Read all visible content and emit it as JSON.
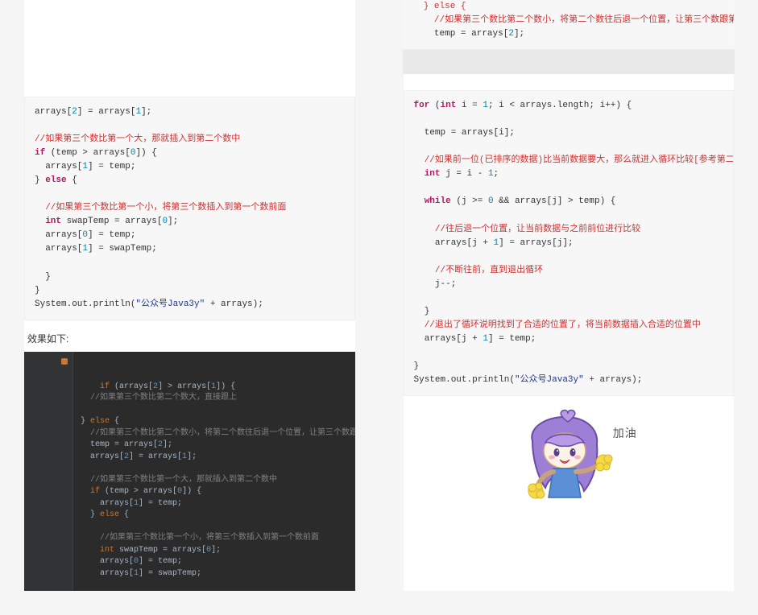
{
  "left": {
    "code_top": [
      {
        "cls": "cm-r",
        "t": "  } else {"
      },
      {
        "cls": "cm-r",
        "t": "    //如果第三个数比第二个数小，将第二个数往后退一个位置，让第三个数跟第一个数比"
      },
      {
        "cls": "",
        "t": "    temp = arrays[<span class='num'>2</span>];"
      }
    ],
    "code_main": [
      {
        "cls": "",
        "t": "arrays[<span class='num'>2</span>] = arrays[<span class='num'>1</span>];"
      },
      {
        "cls": "",
        "t": ""
      },
      {
        "cls": "cm-r",
        "t": "//如果第三个数比第一个大，那就插入到第二个数中"
      },
      {
        "cls": "",
        "t": "<span class='kw'>if</span> (temp &gt; arrays[<span class='num'>0</span>]) {"
      },
      {
        "cls": "",
        "t": "  arrays[<span class='num'>1</span>] = temp;"
      },
      {
        "cls": "",
        "t": "} <span class='kw'>else</span> {"
      },
      {
        "cls": "",
        "t": ""
      },
      {
        "cls": "cm-r",
        "t": "  //如果第三个数比第一个小，将第三个数插入到第一个数前面"
      },
      {
        "cls": "",
        "t": "  <span class='kw'>int</span> swapTemp = arrays[<span class='num'>0</span>];"
      },
      {
        "cls": "",
        "t": "  arrays[<span class='num'>0</span>] = temp;"
      },
      {
        "cls": "",
        "t": "  arrays[<span class='num'>1</span>] = swapTemp;"
      },
      {
        "cls": "",
        "t": ""
      },
      {
        "cls": "",
        "t": "  }"
      },
      {
        "cls": "",
        "t": "}"
      },
      {
        "cls": "",
        "t": "System.out.println(<span class='str'>\"公众号Java3y\"</span> + arrays);"
      }
    ],
    "caption": "效果如下:",
    "dark": [
      {
        "cls": "d-kw",
        "t": "if <span class='d-id'>(arrays[</span><span class='d-num'>2</span><span class='d-id'>] &gt; arrays[</span><span class='d-num'>1</span><span class='d-id'>]) {</span>"
      },
      {
        "cls": "d-cm",
        "t": "  //如果第三个数比第二个数大，直接跟上"
      },
      {
        "cls": "",
        "t": ""
      },
      {
        "cls": "d-id",
        "t": "} <span class='d-kw'>else</span> {"
      },
      {
        "cls": "d-cm",
        "t": "  //如果第三个数比第二个数小，将第二个数往后退一个位置，让第三个数跟第一个数比"
      },
      {
        "cls": "d-id",
        "t": "  temp = arrays[<span class='d-num'>2</span>];"
      },
      {
        "cls": "d-id",
        "t": "  arrays[<span class='d-num'>2</span>] = arrays[<span class='d-num'>1</span>];"
      },
      {
        "cls": "",
        "t": ""
      },
      {
        "cls": "d-cm",
        "t": "  //如果第三个数比第一个大，那就插入到第二个数中"
      },
      {
        "cls": "d-id",
        "t": "  <span class='d-kw'>if</span> (temp &gt; arrays[<span class='d-num'>0</span>]) {"
      },
      {
        "cls": "d-id",
        "t": "    arrays[<span class='d-num'>1</span>] = temp;"
      },
      {
        "cls": "d-id",
        "t": "  } <span class='d-kw'>else</span> {"
      },
      {
        "cls": "",
        "t": ""
      },
      {
        "cls": "d-cm",
        "t": "    //如果第三个数比第一个小，将第三个数插入到第一个数前面"
      },
      {
        "cls": "d-id",
        "t": "    <span class='d-kw'>int</span> swapTemp = arrays[<span class='d-num'>0</span>];"
      },
      {
        "cls": "d-id",
        "t": "    arrays[<span class='d-num'>0</span>] = temp;"
      },
      {
        "cls": "d-id",
        "t": "    arrays[<span class='d-num'>1</span>] = swapTemp;"
      }
    ]
  },
  "right": {
    "code": [
      {
        "cls": "",
        "t": "<span class='kw'>for</span> (<span class='kw'>int</span> i = <span class='num'>1</span>; i &lt; arrays.length; i++) {"
      },
      {
        "cls": "",
        "t": ""
      },
      {
        "cls": "",
        "t": "  temp = arrays[i];"
      },
      {
        "cls": "",
        "t": ""
      },
      {
        "cls": "cm-r",
        "t": "  //如果前一位(已排序的数据)比当前数据要大，那么就进入循环比较[参考第二趟排序]"
      },
      {
        "cls": "",
        "t": "  <span class='kw'>int</span> j = i - <span class='num'>1</span>;"
      },
      {
        "cls": "",
        "t": ""
      },
      {
        "cls": "",
        "t": "  <span class='kw'>while</span> (j &gt;= <span class='num'>0</span> &amp;&amp; arrays[j] &gt; temp) {"
      },
      {
        "cls": "",
        "t": ""
      },
      {
        "cls": "cm-r",
        "t": "    //往后退一个位置，让当前数据与之前前位进行比较"
      },
      {
        "cls": "",
        "t": "    arrays[j + <span class='num'>1</span>] = arrays[j];"
      },
      {
        "cls": "",
        "t": ""
      },
      {
        "cls": "cm-r",
        "t": "    //不断往前，直到退出循环"
      },
      {
        "cls": "",
        "t": "    j--;"
      },
      {
        "cls": "",
        "t": ""
      },
      {
        "cls": "",
        "t": "  }"
      },
      {
        "cls": "cm-r",
        "t": "  //退出了循环说明找到了合适的位置了，将当前数据插入合适的位置中"
      },
      {
        "cls": "",
        "t": "  arrays[j + <span class='num'>1</span>] = temp;"
      },
      {
        "cls": "",
        "t": ""
      },
      {
        "cls": "",
        "t": "}"
      },
      {
        "cls": "",
        "t": "System.out.println(<span class='str'>\"公众号Java3y\"</span> + arrays);"
      }
    ],
    "illustration_label": "加油"
  }
}
